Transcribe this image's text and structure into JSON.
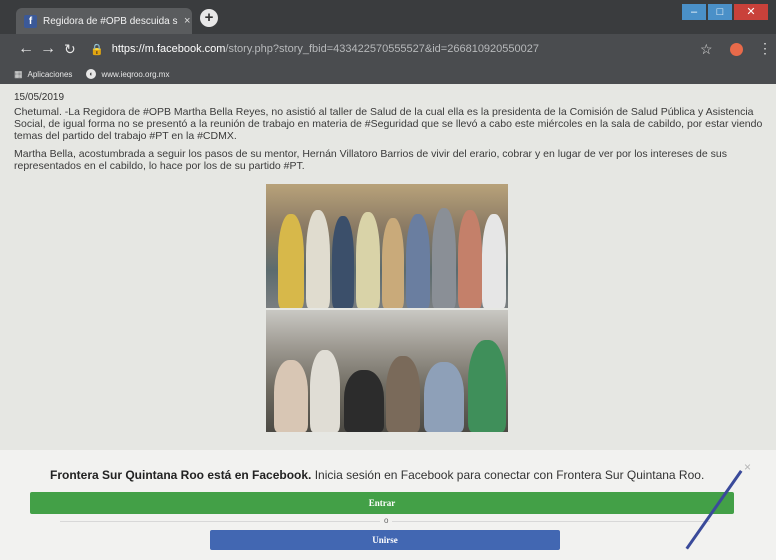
{
  "browser": {
    "tab_title": "Regidora de #OPB descuida su T",
    "tab_close": "×",
    "new_tab": "+",
    "url_host": "https://m.facebook.com",
    "url_path": "/story.php?story_fbid=433422570555527&id=266810920550027",
    "bookmarks": [
      {
        "label": "Aplicaciones",
        "icon": "apps-grid-icon"
      },
      {
        "label": "www.ieqroo.org.mx",
        "icon": "globe-icon"
      }
    ]
  },
  "post": {
    "date": "15/05/2019",
    "paragraph_1": "Chetumal. -La Regidora de #OPB Martha Bella Reyes, no asistió al taller de Salud de la cual ella es la presidenta de la Comisión de Salud Pública y Asistencia Social, de igual forma no se presentó a la reunión de trabajo en materia de #Seguridad que se llevó a cabo este miércoles en la sala de cabildo, por estar viendo temas del partido del trabajo #PT en la #CDMX.",
    "paragraph_2": "Martha Bella, acostumbrada a seguir los pasos de su mentor, Hernán Villatoro Barrios de vivir del erario, cobrar y en lugar de ver por los intereses de sus representados en el cabildo, lo hace por los de su partido #PT."
  },
  "login_banner": {
    "bold_text": "Frontera Sur Quintana Roo está en Facebook.",
    "text": " Inicia sesión en Facebook para conectar con Frontera Sur Quintana Roo.",
    "login_label": "Entrar",
    "or_label": "o",
    "signup_label": "Unirse",
    "close": "×"
  },
  "colors": {
    "login_button": "#43a047",
    "signup_button": "#4267b2",
    "facebook_brand": "#3b5998"
  }
}
